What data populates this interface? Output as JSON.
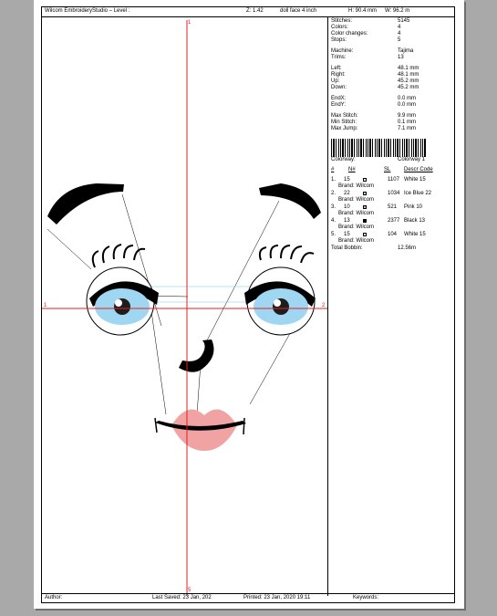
{
  "header": {
    "title": "Wilcom EmbroideryStudio – Level :",
    "zoom": "Z: 1.42",
    "file": "doll face 4 inch",
    "height": "H: 90.4 mm",
    "width": "W: 96.2 m"
  },
  "stats": [
    {
      "k": "Stitches:",
      "v": "5145"
    },
    {
      "k": "Colors:",
      "v": "4"
    },
    {
      "k": "Color changes:",
      "v": "4"
    },
    {
      "k": "Stops:",
      "v": "5"
    }
  ],
  "machine": [
    {
      "k": "Machine:",
      "v": "Tajima"
    },
    {
      "k": "Trims:",
      "v": "13"
    }
  ],
  "extents": [
    {
      "k": "Left:",
      "v": "48.1 mm"
    },
    {
      "k": "Right:",
      "v": "48.1 mm"
    },
    {
      "k": "Up:",
      "v": "45.2 mm"
    },
    {
      "k": "Down:",
      "v": "45.2 mm"
    }
  ],
  "ends": [
    {
      "k": "EndX:",
      "v": "0.0 mm"
    },
    {
      "k": "EndY:",
      "v": "0.0 mm"
    }
  ],
  "stitch_lengths": [
    {
      "k": "Max Stitch:",
      "v": "9.9 mm"
    },
    {
      "k": "Min Stitch:",
      "v": "0.1 mm"
    },
    {
      "k": "Max Jump:",
      "v": "7.1 mm"
    }
  ],
  "colorway": {
    "k": "Colorway:",
    "v": "Colorway 1"
  },
  "table_headers": {
    "num": "#",
    "n": "N#",
    "sl": "SL",
    "desc": "Descr Code"
  },
  "threads": [
    {
      "idx": "1.",
      "n": "15",
      "swatch": "#ffffff",
      "sl": "1107",
      "desc": "White 15",
      "brand": "Brand: Wilcom"
    },
    {
      "idx": "2.",
      "n": "22",
      "swatch": "#9fd6f2",
      "sl": "1034",
      "desc": "Ice Blue 22",
      "brand": "Brand: Wilcom"
    },
    {
      "idx": "3.",
      "n": "10",
      "swatch": "#f1a3a3",
      "sl": "521",
      "desc": "Pink 10",
      "brand": "Brand: Wilcom"
    },
    {
      "idx": "4.",
      "n": "13",
      "swatch": "#000000",
      "sl": "2377",
      "desc": "Black 13",
      "brand": "Brand: Wilcom"
    },
    {
      "idx": "5.",
      "n": "15",
      "swatch": "#ffffff",
      "sl": "104",
      "desc": "White 15",
      "brand": "Brand: Wilcom"
    }
  ],
  "total_bobbin": {
    "k": "Total Bobbin:",
    "v": "12.56m"
  },
  "axes": {
    "top": "1",
    "left": "1",
    "right": "2",
    "bottom": "5"
  },
  "footer": {
    "author": "Author:",
    "last_saved": "Last Saved: 23 Jan, 202",
    "printed": "Printed: 23 Jan, 2020 19:11",
    "keywords": "Keywords:"
  },
  "colors": {
    "crosshair": "#e02020",
    "eye_blue": "#9fd6f2",
    "lip_pink": "#f1a3a3"
  }
}
